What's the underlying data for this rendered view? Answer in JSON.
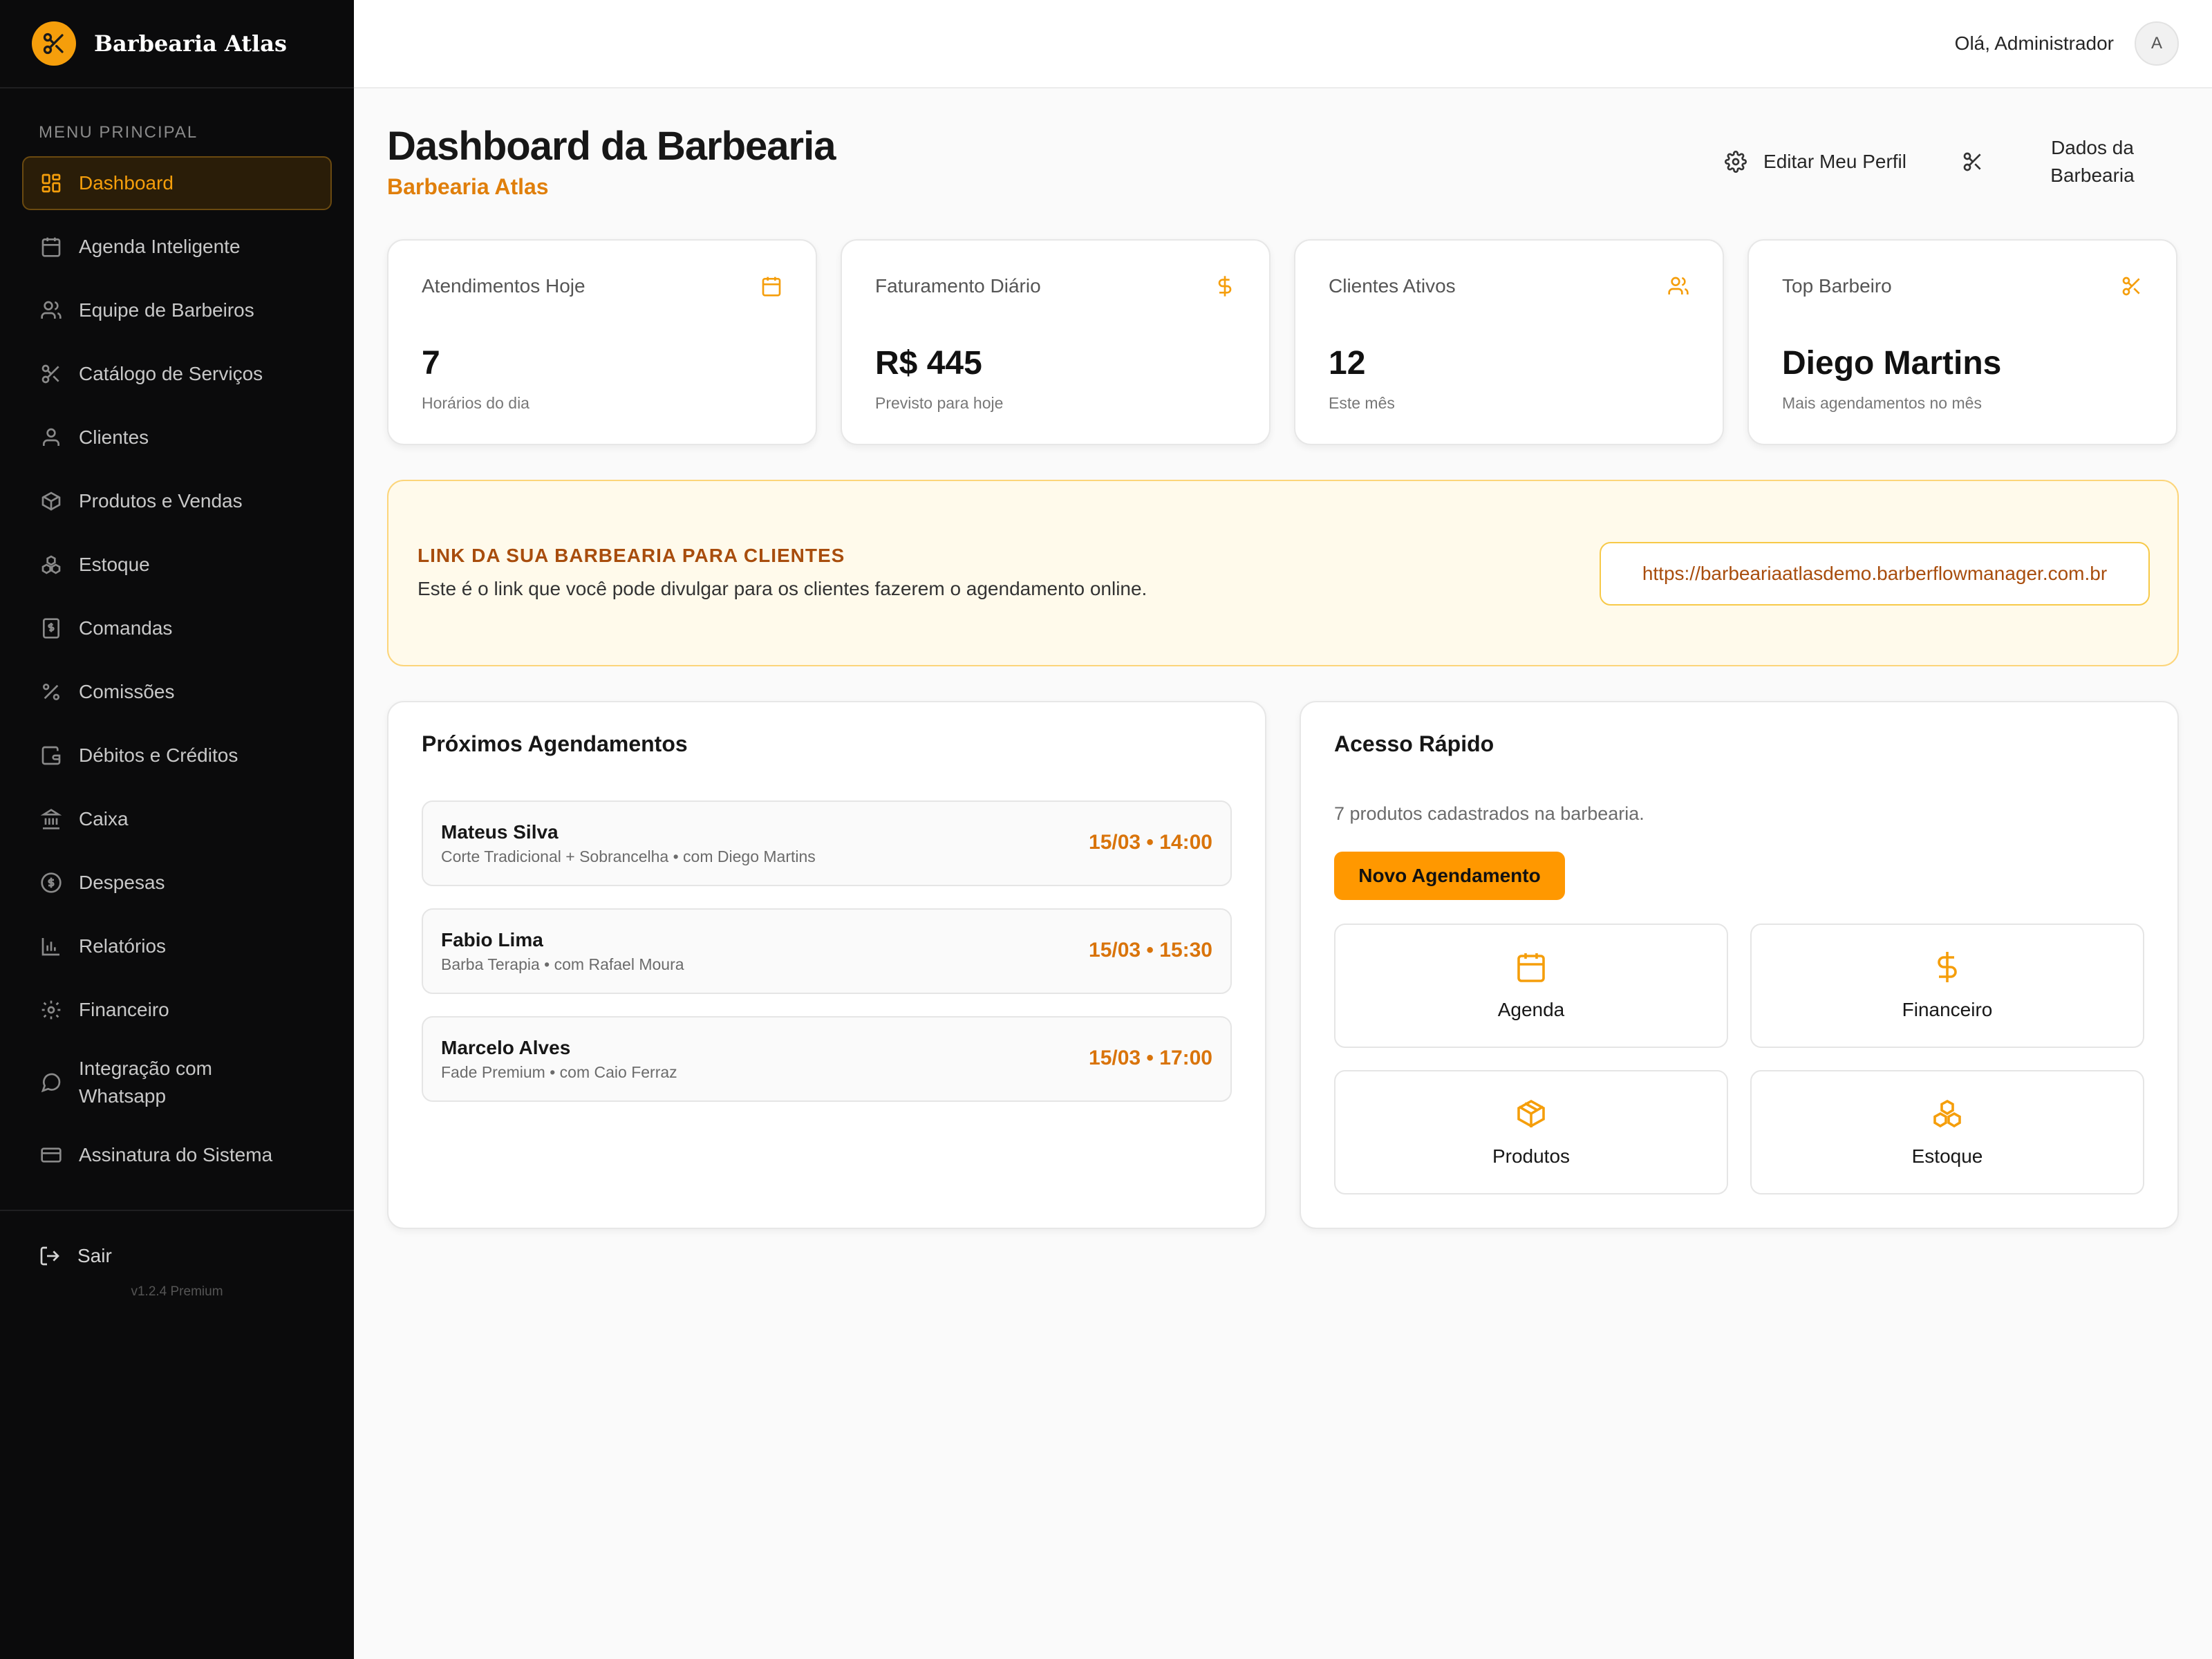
{
  "brand": {
    "name": "Barbearia Atlas",
    "icon": "scissors-icon",
    "accent": "#f59e0b"
  },
  "sidebar": {
    "section_title": "MENU PRINCIPAL",
    "items": [
      {
        "label": "Dashboard",
        "icon": "layout-grid-icon",
        "active": true
      },
      {
        "label": "Agenda Inteligente",
        "icon": "calendar-icon"
      },
      {
        "label": "Equipe de Barbeiros",
        "icon": "users-icon"
      },
      {
        "label": "Catálogo de Serviços",
        "icon": "scissors-icon"
      },
      {
        "label": "Clientes",
        "icon": "user-icon"
      },
      {
        "label": "Produtos e Vendas",
        "icon": "package-icon"
      },
      {
        "label": "Estoque",
        "icon": "boxes-icon"
      },
      {
        "label": "Comandas",
        "icon": "receipt-icon"
      },
      {
        "label": "Comissões",
        "icon": "percent-icon"
      },
      {
        "label": "Débitos e Créditos",
        "icon": "wallet-icon"
      },
      {
        "label": "Caixa",
        "icon": "landmark-icon"
      },
      {
        "label": "Despesas",
        "icon": "dollar-circle-icon"
      },
      {
        "label": "Relatórios",
        "icon": "bar-chart-icon"
      },
      {
        "label": "Financeiro",
        "icon": "gear-icon"
      },
      {
        "label": "Integração com Whatsapp",
        "icon": "chat-icon"
      },
      {
        "label": "Assinatura do Sistema",
        "icon": "credit-card-icon"
      }
    ],
    "logout_label": "Sair",
    "version": "v1.2.4 Premium"
  },
  "topbar": {
    "greeting": "Olá, Administrador",
    "avatar_initial": "A"
  },
  "header": {
    "title": "Dashboard da Barbearia",
    "subtitle": "Barbearia Atlas",
    "edit_profile_label": "Editar Meu Perfil",
    "shop_data_label": "Dados da Barbearia"
  },
  "stats": [
    {
      "title": "Atendimentos Hoje",
      "value": "7",
      "sub": "Horários do dia",
      "icon": "calendar-icon"
    },
    {
      "title": "Faturamento Diário",
      "value": "R$ 445",
      "sub": "Previsto para hoje",
      "icon": "dollar-icon"
    },
    {
      "title": "Clientes Ativos",
      "value": "12",
      "sub": "Este mês",
      "icon": "users-icon"
    },
    {
      "title": "Top Barbeiro",
      "value": "Diego Martins",
      "sub": "Mais agendamentos no mês",
      "icon": "scissors-icon"
    }
  ],
  "banner": {
    "title": "LINK DA SUA BARBEARIA PARA CLIENTES",
    "text": "Este é o link que você pode divulgar para os clientes fazerem o agendamento online.",
    "link": "https://barbeariaatlasdemo.barberflowmanager.com.br"
  },
  "appointments": {
    "title": "Próximos Agendamentos",
    "items": [
      {
        "name": "Mateus Silva",
        "detail": "Corte Tradicional + Sobrancelha • com Diego Martins",
        "time": "15/03 • 14:00"
      },
      {
        "name": "Fabio Lima",
        "detail": "Barba Terapia • com Rafael Moura",
        "time": "15/03 • 15:30"
      },
      {
        "name": "Marcelo Alves",
        "detail": "Fade Premium • com Caio Ferraz",
        "time": "15/03 • 17:00"
      }
    ]
  },
  "quick_access": {
    "title": "Acesso Rápido",
    "text": "7 produtos cadastrados na barbearia.",
    "button_label": "Novo Agendamento",
    "tiles": [
      {
        "label": "Agenda",
        "icon": "calendar-icon"
      },
      {
        "label": "Financeiro",
        "icon": "dollar-icon"
      },
      {
        "label": "Produtos",
        "icon": "package-icon"
      },
      {
        "label": "Estoque",
        "icon": "boxes-icon"
      }
    ]
  }
}
